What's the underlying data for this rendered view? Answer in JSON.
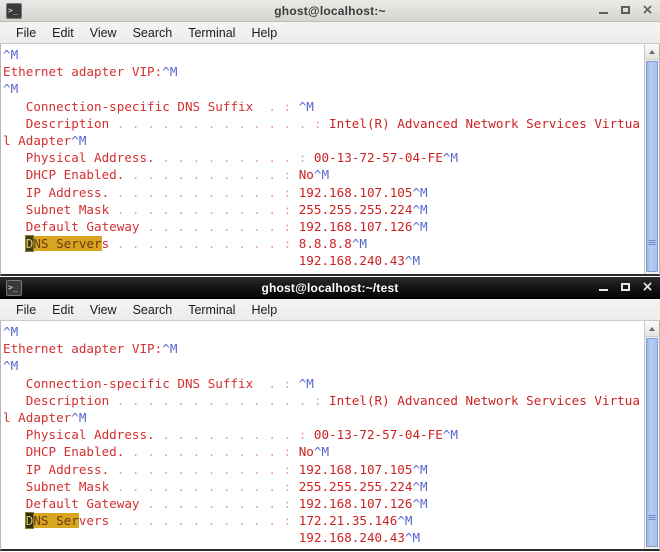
{
  "windows": [
    {
      "id": "terminal-one",
      "active": false,
      "title": "ghost@localhost:~",
      "icon": "terminal-icon",
      "menu": [
        "File",
        "Edit",
        "View",
        "Search",
        "Terminal",
        "Help"
      ],
      "buttons": {
        "minimize": "_",
        "maximize": "□",
        "close": "×"
      },
      "lines": [
        {
          "segments": [
            {
              "t": "",
              "c": "plain"
            },
            {
              "t": "^M",
              "c": "ctl"
            }
          ]
        },
        {
          "segments": [
            {
              "t": "Ethernet adapter VIP:",
              "c": "plain"
            },
            {
              "t": "^M",
              "c": "ctl"
            }
          ]
        },
        {
          "segments": [
            {
              "t": "^M",
              "c": "ctl"
            }
          ]
        },
        {
          "segments": [
            {
              "t": "   Connection-specific DNS Suffix  ",
              "c": "plain"
            },
            {
              "t": ". : ",
              "c": "dots"
            },
            {
              "t": "^M",
              "c": "ctl"
            }
          ]
        },
        {
          "segments": [
            {
              "t": "   Description ",
              "c": "plain"
            },
            {
              "t": ". . . . . . . . . . . . . : ",
              "c": "dots"
            },
            {
              "t": "Intel(R) Advanced Network Services Virtua",
              "c": "val"
            }
          ]
        },
        {
          "segments": [
            {
              "t": "l Adapter",
              "c": "plain"
            },
            {
              "t": "^M",
              "c": "ctl"
            }
          ]
        },
        {
          "segments": [
            {
              "t": "   Physical Address.",
              "c": "plain"
            },
            {
              "t": " . . . . . . . . . : ",
              "c": "dots"
            },
            {
              "t": "00-13-72-57-04-FE",
              "c": "val"
            },
            {
              "t": "^M",
              "c": "ctl"
            }
          ]
        },
        {
          "segments": [
            {
              "t": "   DHCP Enabled.",
              "c": "plain"
            },
            {
              "t": " . . . . . . . . . . : ",
              "c": "dots"
            },
            {
              "t": "No",
              "c": "val"
            },
            {
              "t": "^M",
              "c": "ctl"
            }
          ]
        },
        {
          "segments": [
            {
              "t": "   IP Address.",
              "c": "plain"
            },
            {
              "t": " . . . . . . . . . . . : ",
              "c": "dots"
            },
            {
              "t": "192.168.107.105",
              "c": "val"
            },
            {
              "t": "^M",
              "c": "ctl"
            }
          ]
        },
        {
          "segments": [
            {
              "t": "   Subnet Mask ",
              "c": "plain"
            },
            {
              "t": ". . . . . . . . . . . : ",
              "c": "dots"
            },
            {
              "t": "255.255.255.224",
              "c": "val"
            },
            {
              "t": "^M",
              "c": "ctl"
            }
          ]
        },
        {
          "segments": [
            {
              "t": "   Default Gateway ",
              "c": "plain"
            },
            {
              "t": ". . . . . . . . . : ",
              "c": "dots"
            },
            {
              "t": "192.168.107.126",
              "c": "val"
            },
            {
              "t": "^M",
              "c": "ctl"
            }
          ]
        },
        {
          "segments": [
            {
              "t": "   ",
              "c": "plain"
            },
            {
              "t": "D",
              "c": "hl-cursor"
            },
            {
              "t": "NS Server",
              "c": "hl"
            },
            {
              "t": "s ",
              "c": "plain"
            },
            {
              "t": ". . . . . . . . . . . : ",
              "c": "dots"
            },
            {
              "t": "8.8.8.8",
              "c": "val"
            },
            {
              "t": "^M",
              "c": "ctl"
            }
          ]
        },
        {
          "segments": [
            {
              "t": "                                       ",
              "c": "plain"
            },
            {
              "t": "192.168.240.43",
              "c": "val"
            },
            {
              "t": "^M",
              "c": "ctl"
            }
          ]
        }
      ],
      "scrollbar": {
        "arrow": "scroll-up-arrow",
        "thumb": "scroll-thumb"
      }
    },
    {
      "id": "terminal-two",
      "active": true,
      "title": "ghost@localhost:~/test",
      "icon": "terminal-icon",
      "menu": [
        "File",
        "Edit",
        "View",
        "Search",
        "Terminal",
        "Help"
      ],
      "buttons": {
        "minimize": "_",
        "maximize": "□",
        "close": "×"
      },
      "lines": [
        {
          "segments": [
            {
              "t": "^M",
              "c": "ctl"
            }
          ]
        },
        {
          "segments": [
            {
              "t": "Ethernet adapter VIP:",
              "c": "plain"
            },
            {
              "t": "^M",
              "c": "ctl"
            }
          ]
        },
        {
          "segments": [
            {
              "t": "^M",
              "c": "ctl"
            }
          ]
        },
        {
          "segments": [
            {
              "t": "   Connection-specific DNS Suffix  ",
              "c": "plain"
            },
            {
              "t": ". : ",
              "c": "dots"
            },
            {
              "t": "^M",
              "c": "ctl"
            }
          ]
        },
        {
          "segments": [
            {
              "t": "   Description ",
              "c": "plain"
            },
            {
              "t": ". . . . . . . . . . . . . : ",
              "c": "dots"
            },
            {
              "t": "Intel(R) Advanced Network Services Virtua",
              "c": "val"
            }
          ]
        },
        {
          "segments": [
            {
              "t": "l Adapter",
              "c": "plain"
            },
            {
              "t": "^M",
              "c": "ctl"
            }
          ]
        },
        {
          "segments": [
            {
              "t": "   Physical Address.",
              "c": "plain"
            },
            {
              "t": " . . . . . . . . . : ",
              "c": "dots"
            },
            {
              "t": "00-13-72-57-04-FE",
              "c": "val"
            },
            {
              "t": "^M",
              "c": "ctl"
            }
          ]
        },
        {
          "segments": [
            {
              "t": "   DHCP Enabled.",
              "c": "plain"
            },
            {
              "t": " . . . . . . . . . . : ",
              "c": "dots"
            },
            {
              "t": "No",
              "c": "val"
            },
            {
              "t": "^M",
              "c": "ctl"
            }
          ]
        },
        {
          "segments": [
            {
              "t": "   IP Address.",
              "c": "plain"
            },
            {
              "t": " . . . . . . . . . . . : ",
              "c": "dots"
            },
            {
              "t": "192.168.107.105",
              "c": "val"
            },
            {
              "t": "^M",
              "c": "ctl"
            }
          ]
        },
        {
          "segments": [
            {
              "t": "   Subnet Mask ",
              "c": "plain"
            },
            {
              "t": ". . . . . . . . . . . : ",
              "c": "dots"
            },
            {
              "t": "255.255.255.224",
              "c": "val"
            },
            {
              "t": "^M",
              "c": "ctl"
            }
          ]
        },
        {
          "segments": [
            {
              "t": "   Default Gateway ",
              "c": "plain"
            },
            {
              "t": ". . . . . . . . . : ",
              "c": "dots"
            },
            {
              "t": "192.168.107.126",
              "c": "val"
            },
            {
              "t": "^M",
              "c": "ctl"
            }
          ]
        },
        {
          "segments": [
            {
              "t": "   ",
              "c": "plain"
            },
            {
              "t": "D",
              "c": "hl-cursor"
            },
            {
              "t": "NS Ser",
              "c": "hl"
            },
            {
              "t": "vers ",
              "c": "plain"
            },
            {
              "t": ". . . . . . . . . . . : ",
              "c": "dots"
            },
            {
              "t": "172.21.35.146",
              "c": "val"
            },
            {
              "t": "^M",
              "c": "ctl"
            }
          ]
        },
        {
          "segments": [
            {
              "t": "                                       ",
              "c": "plain"
            },
            {
              "t": "192.168.240.43",
              "c": "val"
            },
            {
              "t": "^M",
              "c": "ctl"
            }
          ]
        }
      ],
      "scrollbar": {
        "arrow": "scroll-up-arrow",
        "thumb": "scroll-thumb"
      }
    }
  ],
  "colors": {
    "terminal_text": "#d33030",
    "control_glyph": "#5566cc",
    "highlight_bg": "#d8a520",
    "cursor_bg": "#3d3d18",
    "active_titlebar": "#0a0a0a",
    "inactive_titlebar": "#dededa",
    "scrollbar_thumb": "#a8c0ec"
  }
}
